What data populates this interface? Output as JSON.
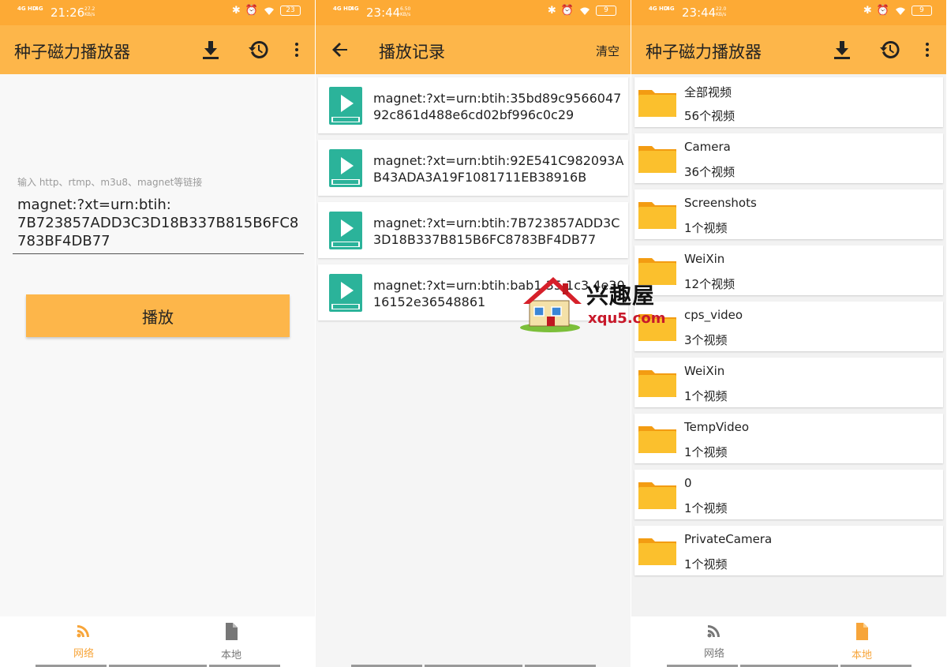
{
  "colors": {
    "statusbar": "#fdaa35",
    "appbar": "#fdb64a",
    "accent": "#f7a53a",
    "video_icon": "#2bb39a",
    "folder": "#fbc02d"
  },
  "screen1": {
    "status": {
      "sig1": "4G HD",
      "sig2": "4G",
      "time": "21:26",
      "speed": "27.2\nKB/s",
      "battery": "23"
    },
    "appbar": {
      "title": "种子磁力播放器",
      "icons": [
        "download-icon",
        "history-icon",
        "more-icon"
      ]
    },
    "input": {
      "hint": "输入 http、rtmp、m3u8、magnet等链接",
      "value": "magnet:?xt=urn:btih:\n7B723857ADD3C3D18B337B815B6FC8783BF4DB77"
    },
    "play_button": "播放",
    "nav": {
      "network": "网络",
      "local": "本地"
    }
  },
  "screen2": {
    "status": {
      "sig1": "4G HD",
      "sig2": "4G",
      "time": "23:44",
      "speed": "6.50\nKB/s",
      "battery": "9"
    },
    "appbar": {
      "title": "播放记录",
      "clear": "清空"
    },
    "history": [
      {
        "text": "magnet:?xt=urn:btih:35bd89c956604792c861d488e6cd02bf996c0c29",
        "icon_label": "VIDEOS"
      },
      {
        "text": "magnet:?xt=urn:btih:92E541C982093AB43ADA3A19F1081711EB38916B",
        "icon_label": "VIDEOS"
      },
      {
        "text": "magnet:?xt=urn:btih:7B723857ADD3C3D18B337B815B6FC8783BF4DB77",
        "icon_label": "VIDEOS"
      },
      {
        "text": "magnet:?xt=urn:btih:bab1        35 1c3 4e3016152e36548861",
        "icon_label": "VIDEOS"
      }
    ]
  },
  "screen3": {
    "status": {
      "sig1": "4G HD",
      "sig2": "4G",
      "time": "23:44",
      "speed": "22.0\nKB/s",
      "battery": "9"
    },
    "appbar": {
      "title": "种子磁力播放器"
    },
    "folders": [
      {
        "name": "全部视频",
        "count": "56个视频"
      },
      {
        "name": "Camera",
        "count": "36个视频"
      },
      {
        "name": "Screenshots",
        "count": "1个视频"
      },
      {
        "name": "WeiXin",
        "count": "12个视频"
      },
      {
        "name": "cps_video",
        "count": "3个视频"
      },
      {
        "name": "WeiXin",
        "count": "1个视频"
      },
      {
        "name": "TempVideo",
        "count": "1个视频"
      },
      {
        "name": "0",
        "count": "1个视频"
      },
      {
        "name": "PrivateCamera",
        "count": "1个视频"
      }
    ],
    "nav": {
      "network": "网络",
      "local": "本地"
    }
  },
  "watermark": {
    "title": "兴趣屋",
    "url": "xqu5.com"
  }
}
